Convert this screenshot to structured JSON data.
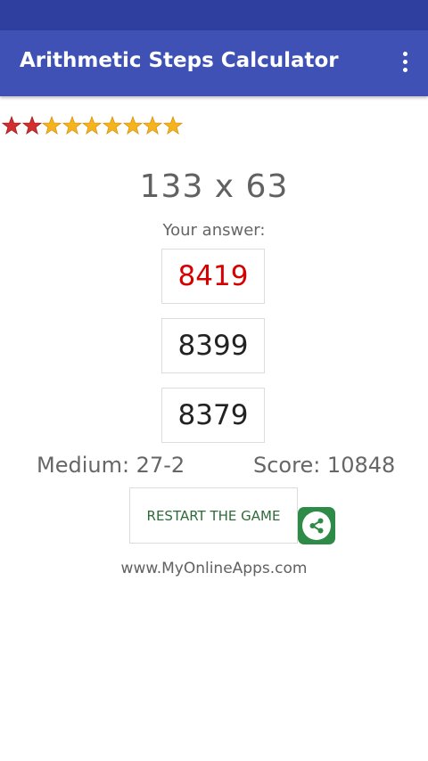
{
  "app": {
    "title": "Arithmetic Steps Calculator",
    "menu_icon": "more-vert-icon",
    "colors": {
      "status_bar": "#2f3f9f",
      "app_bar": "#3f51b5",
      "wrong_answer": "#d50000",
      "share_button": "#2e8b47"
    }
  },
  "rating": {
    "total_stars": 9,
    "red_stars": 2,
    "gold_stars": 7,
    "icon": "star-icon"
  },
  "game": {
    "problem": "133 x 63",
    "prompt": "Your answer:",
    "answers": [
      {
        "value": "8419",
        "state": "wrong"
      },
      {
        "value": "8399",
        "state": "normal"
      },
      {
        "value": "8379",
        "state": "normal"
      }
    ],
    "level_text": "Medium: 27-2",
    "score_text": "Score: 10848",
    "restart_label": "RESTART THE GAME",
    "share_icon": "share-icon",
    "website": "www.MyOnlineApps.com"
  }
}
